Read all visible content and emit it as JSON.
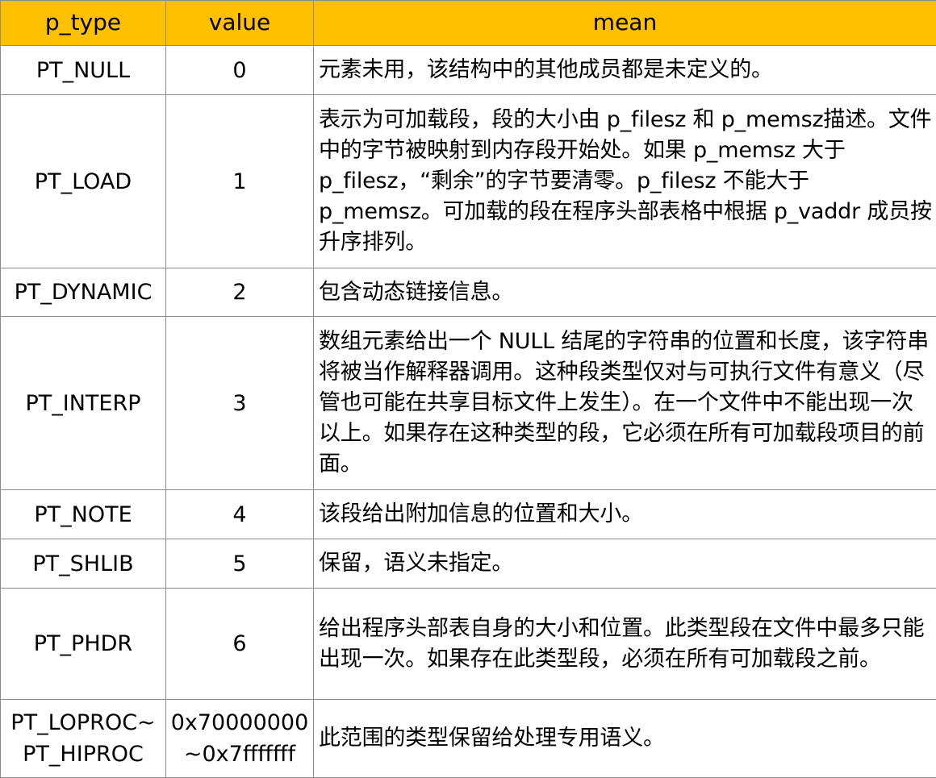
{
  "table": {
    "header": {
      "type": "p_type",
      "value": "value",
      "mean": "mean"
    },
    "rows": [
      {
        "type": "PT_NULL",
        "value": "0",
        "mean": "元素未用，该结构中的其他成员都是未定义的。"
      },
      {
        "type": "PT_LOAD",
        "value": "1",
        "mean": "表示为可加载段，段的大小由 p_filesz 和 p_memsz描述。文件中的字节被映射到内存段开始处。如果 p_memsz 大于 p_filesz，“剩余”的字节要清零。p_filesz 不能大于 p_memsz。可加载的段在程序头部表格中根据 p_vaddr 成员按升序排列。"
      },
      {
        "type": "PT_DYNAMIC",
        "value": "2",
        "mean": "包含动态链接信息。"
      },
      {
        "type": "PT_INTERP",
        "value": "3",
        "mean": "数组元素给出一个 NULL 结尾的字符串的位置和长度，该字符串将被当作解释器调用。这种段类型仅对与可执行文件有意义（尽管也可能在共享目标文件上发生）。在一个文件中不能出现一次以上。如果存在这种类型的段，它必须在所有可加载段项目的前面。"
      },
      {
        "type": "PT_NOTE",
        "value": "4",
        "mean": "该段给出附加信息的位置和大小。"
      },
      {
        "type": "PT_SHLIB",
        "value": "5",
        "mean": "保留，语义未指定。"
      },
      {
        "type": "PT_PHDR",
        "value": "6",
        "mean": "给出程序头部表自身的大小和位置。此类型段在文件中最多只能出现一次。如果存在此类型段，必须在所有可加载段之前。"
      },
      {
        "type_line1": "PT_LOPROC~",
        "type_line2": "PT_HIPROC",
        "value_line1": "0x70000000",
        "value_line2": "~0x7fffffff",
        "mean": "此范围的类型保留给处理专用语义。"
      }
    ]
  },
  "colors": {
    "header_background": "#ffc000",
    "border": "#8c8c8c",
    "text": "#000000"
  }
}
